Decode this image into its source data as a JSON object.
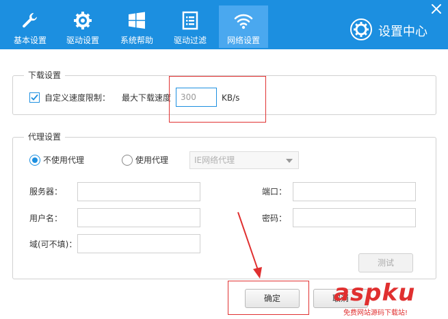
{
  "window": {
    "title": "设置中心",
    "accent": "#1c8fe0"
  },
  "tabs": [
    {
      "label": "基本设置",
      "icon": "wrench-icon"
    },
    {
      "label": "驱动设置",
      "icon": "gear-icon"
    },
    {
      "label": "系统帮助",
      "icon": "windows-icon"
    },
    {
      "label": "驱动过滤",
      "icon": "list-icon"
    },
    {
      "label": "网络设置",
      "icon": "wifi-icon",
      "active": true
    }
  ],
  "download": {
    "legend": "下载设置",
    "custom_limit_label": "自定义速度限制：",
    "custom_limit_checked": true,
    "max_speed_label": "最大下载速度",
    "max_speed_value": "300",
    "unit": "KB/s"
  },
  "proxy": {
    "legend": "代理设置",
    "no_proxy_label": "不使用代理",
    "use_proxy_label": "使用代理",
    "selected": "不使用代理",
    "proxy_type": "IE网络代理",
    "server_label": "服务器：",
    "port_label": "端口：",
    "username_label": "用户名：",
    "password_label": "密码：",
    "domain_label": "域(可不填)：",
    "test_button": "测试"
  },
  "footer": {
    "ok_button": "确定",
    "cancel_button": "取消"
  },
  "watermark": {
    "brand": "aspku",
    "tagline": "免费网站源码下载站!"
  }
}
